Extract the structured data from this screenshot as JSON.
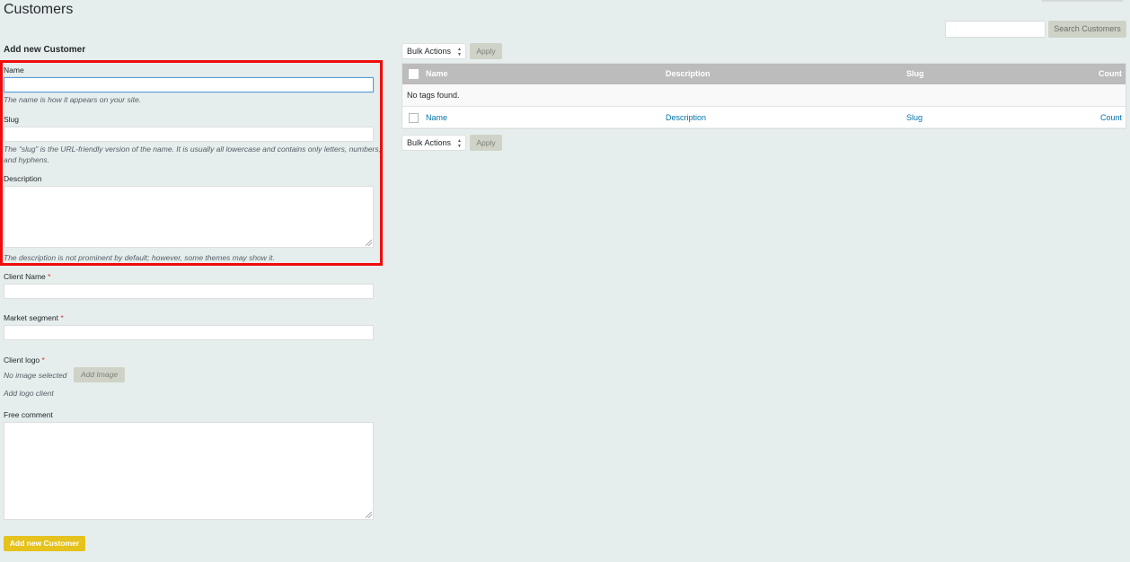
{
  "page": {
    "title": "Customers"
  },
  "search": {
    "placeholder": "",
    "value": "",
    "button_label": "Search Customers"
  },
  "form": {
    "heading": "Add new Customer",
    "name": {
      "label": "Name",
      "value": "",
      "hint": "The name is how it appears on your site."
    },
    "slug": {
      "label": "Slug",
      "value": "",
      "hint": "The “slug” is the URL-friendly version of the name. It is usually all lowercase and contains only letters, numbers, and hyphens."
    },
    "description": {
      "label": "Description",
      "value": "",
      "hint": "The description is not prominent by default; however, some themes may show it."
    },
    "client_name": {
      "label": "Client Name",
      "required_marker": "*",
      "value": ""
    },
    "market_segment": {
      "label": "Market segment",
      "required_marker": "*",
      "value": ""
    },
    "client_logo": {
      "label": "Client logo",
      "required_marker": "*",
      "status": "No image selected",
      "button_label": "Add Image",
      "hint": "Add logo client"
    },
    "free_comment": {
      "label": "Free comment",
      "value": ""
    },
    "submit_label": "Add new Customer"
  },
  "list": {
    "bulk_actions_top": {
      "selected": "Bulk Actions",
      "apply_label": "Apply"
    },
    "bulk_actions_bottom": {
      "selected": "Bulk Actions",
      "apply_label": "Apply"
    },
    "columns": [
      "Name",
      "Description",
      "Slug",
      "Count"
    ],
    "empty_message": "No tags found.",
    "footer_columns": [
      "Name",
      "Description",
      "Slug",
      "Count"
    ]
  },
  "colors": {
    "background": "#e6eeed",
    "highlight_border": "#f00c0c",
    "primary_button": "#e5c21c",
    "secondary_button": "#cfd3c7",
    "table_header": "#bcbcbc",
    "link": "#0073aa"
  }
}
